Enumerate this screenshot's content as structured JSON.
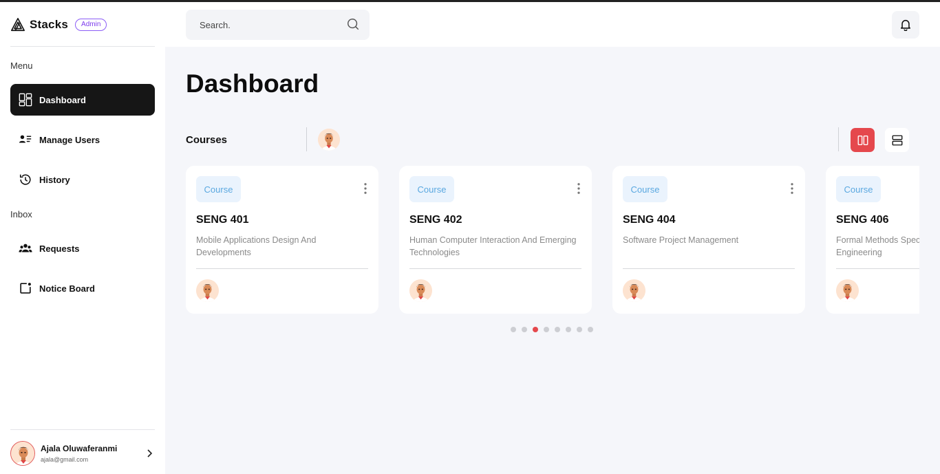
{
  "brand": {
    "name": "Stacks",
    "badge": "Admin"
  },
  "search": {
    "placeholder": "Search."
  },
  "sidebar": {
    "menu_label": "Menu",
    "menu_items": [
      {
        "label": "Dashboard",
        "icon": "dashboard-icon",
        "active": true
      },
      {
        "label": "Manage Users",
        "icon": "users-list-icon",
        "active": false
      },
      {
        "label": "History",
        "icon": "history-icon",
        "active": false
      }
    ],
    "inbox_label": "Inbox",
    "inbox_items": [
      {
        "label": "Requests",
        "icon": "group-icon"
      },
      {
        "label": "Notice Board",
        "icon": "notice-board-icon"
      }
    ]
  },
  "user": {
    "name": "Ajala Oluwaferanmi",
    "email": "ajala@gmail.com"
  },
  "main": {
    "title": "Dashboard",
    "courses_label": "Courses",
    "cards": [
      {
        "tag": "Course",
        "code": "SENG 401",
        "desc": "Mobile Applications Design And Developments"
      },
      {
        "tag": "Course",
        "code": "SENG 402",
        "desc": "Human Computer Interaction And Emerging Technologies"
      },
      {
        "tag": "Course",
        "code": "SENG 404",
        "desc": "Software Project Management"
      },
      {
        "tag": "Course",
        "code": "SENG 406",
        "desc": "Formal Methods Specification In Software Engineering"
      }
    ],
    "pagination": {
      "total": 8,
      "active_index": 2
    }
  },
  "colors": {
    "accent": "#e5484d",
    "active_nav": "#161616",
    "tag_bg": "#eaf3fd",
    "tag_text": "#5aa8e0",
    "admin_badge": "#7c3aed"
  }
}
